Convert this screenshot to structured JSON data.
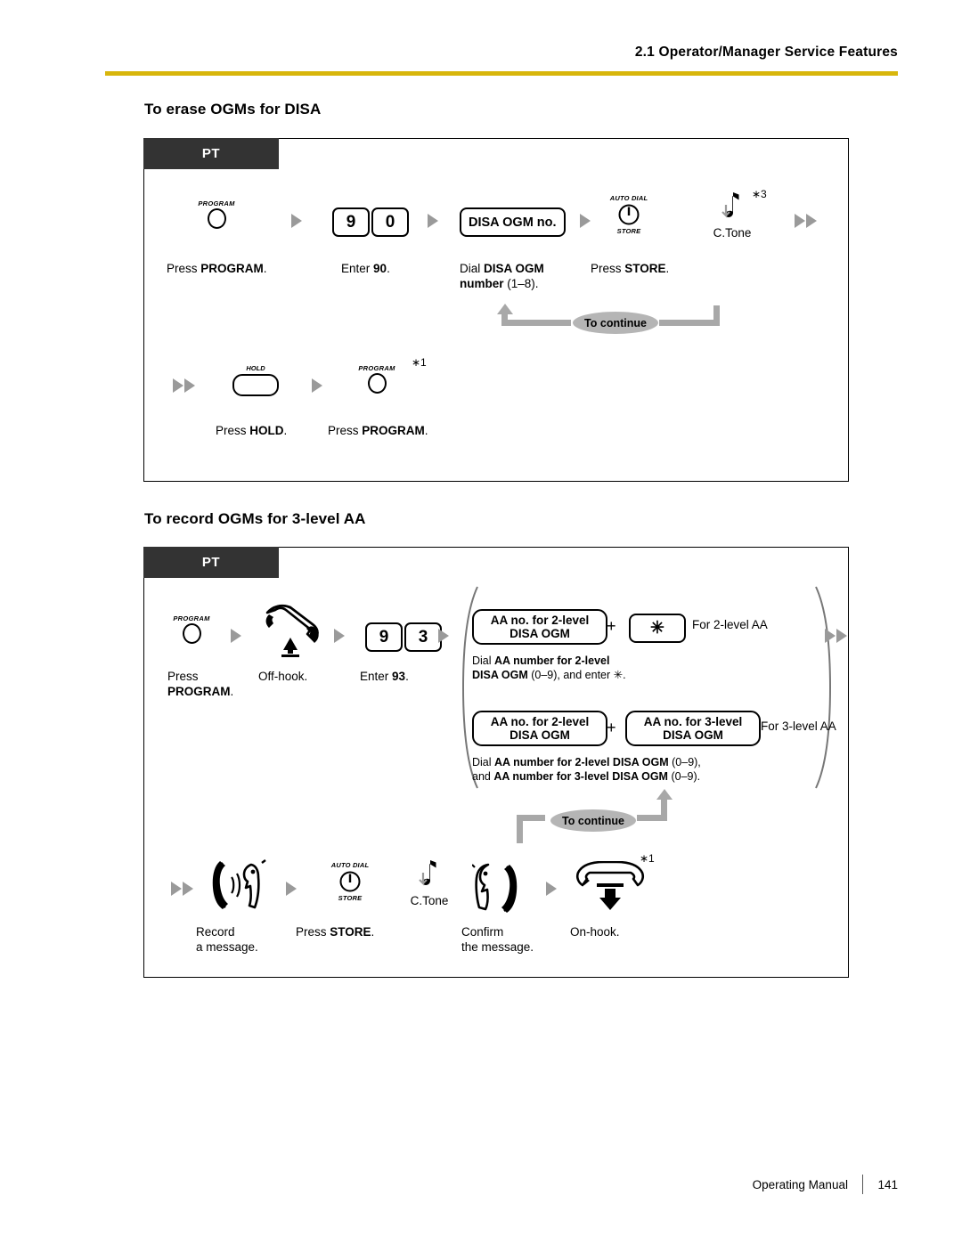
{
  "header": {
    "chapter_title": "2.1 Operator/Manager Service Features",
    "rule_color": "#d8b60c"
  },
  "sections": [
    {
      "heading": "To erase OGMs for DISA",
      "tab_label": "PT",
      "rows": [
        {
          "steps": [
            {
              "icon": "program-round-key-icon",
              "key_label": "PROGRAM",
              "caption_prefix": "Press ",
              "caption_bold": "PROGRAM",
              "caption_suffix": "."
            },
            {
              "icon": "arrow-right-icon"
            },
            {
              "icon": "digit-keys-icon",
              "keys": [
                "9",
                "0"
              ],
              "caption_prefix": "Enter ",
              "caption_bold": "90",
              "caption_suffix": "."
            },
            {
              "icon": "arrow-right-icon"
            },
            {
              "icon": "pill-key-icon",
              "pill_label": "DISA OGM no.",
              "caption_line1_prefix": "Dial ",
              "caption_line1_bold": "DISA OGM",
              "caption_line2_bold": "number",
              "caption_line2_suffix": " (1–8)."
            },
            {
              "icon": "arrow-right-icon"
            },
            {
              "icon": "auto-dial-store-key-icon",
              "key_top": "AUTO DIAL",
              "key_bottom": "STORE",
              "caption_prefix": "Press ",
              "caption_bold": "STORE",
              "caption_suffix": "."
            },
            {
              "icon": "confirmation-tone-icon",
              "tone_label": "C.Tone",
              "footnote": "∗3"
            },
            {
              "icon": "double-arrow-right-icon"
            }
          ],
          "continue_label": "To continue"
        },
        {
          "steps": [
            {
              "icon": "double-arrow-right-icon"
            },
            {
              "icon": "hold-key-icon",
              "key_label": "HOLD",
              "caption_prefix": "Press ",
              "caption_bold": "HOLD",
              "caption_suffix": "."
            },
            {
              "icon": "arrow-right-icon"
            },
            {
              "icon": "program-round-key-icon",
              "key_label": "PROGRAM",
              "footnote": "∗1",
              "caption_prefix": "Press ",
              "caption_bold": "PROGRAM",
              "caption_suffix": "."
            }
          ]
        }
      ]
    },
    {
      "heading": "To record OGMs for 3-level AA",
      "tab_label": "PT",
      "rows": [
        {
          "steps": [
            {
              "icon": "program-round-key-icon",
              "key_label": "PROGRAM",
              "caption_line1": "Press",
              "caption_line2_bold": "PROGRAM",
              "caption_line2_suffix": "."
            },
            {
              "icon": "arrow-right-icon"
            },
            {
              "icon": "off-hook-handset-icon",
              "caption": "Off-hook."
            },
            {
              "icon": "arrow-right-icon"
            },
            {
              "icon": "digit-keys-icon",
              "keys": [
                "9",
                "3"
              ],
              "caption_prefix": "Enter ",
              "caption_bold": "93",
              "caption_suffix": "."
            },
            {
              "icon": "arrow-right-icon"
            }
          ],
          "branch": {
            "options": [
              {
                "key1_line1": "AA no. for 2-level",
                "key1_line2": "DISA OGM",
                "plus": "+",
                "key2_symbol": "✳",
                "side_label": "For 2-level AA",
                "note_line1_plain": "Dial ",
                "note_line1_bold": "AA number for 2-level",
                "note_line2_bold": "DISA OGM",
                "note_line2_plain": " (0–9), and enter ✳."
              },
              {
                "key1_line1": "AA no. for 2-level",
                "key1_line2": "DISA OGM",
                "plus": "+",
                "key2_line1": "AA no. for 3-level",
                "key2_line2": "DISA OGM",
                "side_label": "For 3-level AA",
                "note_line1_plain": "Dial ",
                "note_line1_bold": "AA number for 2-level DISA OGM",
                "note_line1_plain2": " (0–9),",
                "note_line2_plain": "and ",
                "note_line2_bold": "AA number for 3-level DISA OGM",
                "note_line2_plain2": " (0–9)."
              }
            ]
          },
          "exit_arrow": "double-arrow-right-icon"
        },
        {
          "continue_label": "To continue",
          "steps": [
            {
              "icon": "double-arrow-right-icon"
            },
            {
              "icon": "record-message-icon",
              "caption_line1": "Record",
              "caption_line2": "a message."
            },
            {
              "icon": "arrow-right-icon"
            },
            {
              "icon": "auto-dial-store-key-icon",
              "key_top": "AUTO DIAL",
              "key_bottom": "STORE",
              "caption_prefix": "Press ",
              "caption_bold": "STORE",
              "caption_suffix": "."
            },
            {
              "icon": "confirmation-tone-icon",
              "tone_label": "C.Tone"
            },
            {
              "icon": "confirm-message-icon",
              "caption_line1": "Confirm",
              "caption_line2": "the message."
            },
            {
              "icon": "arrow-right-icon"
            },
            {
              "icon": "on-hook-handset-icon",
              "footnote": "∗1",
              "caption": "On-hook."
            }
          ]
        }
      ]
    }
  ],
  "footer": {
    "manual_name": "Operating Manual",
    "page_number": "141"
  }
}
